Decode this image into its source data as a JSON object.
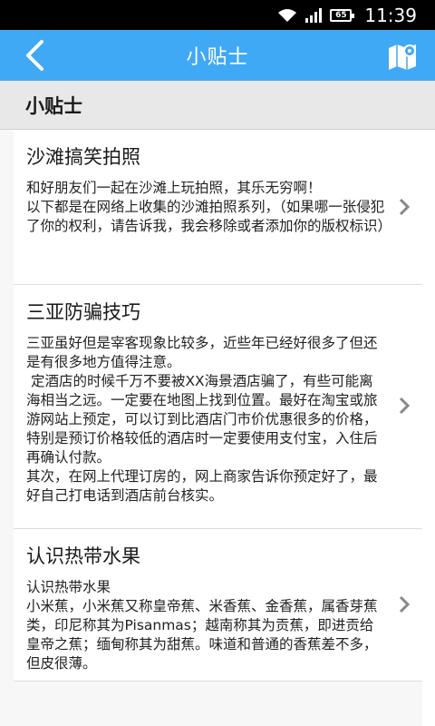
{
  "status_bar": {
    "battery": "65",
    "time": "11:39"
  },
  "app_bar": {
    "title": "小贴士"
  },
  "section": {
    "title": "小贴士"
  },
  "tips": [
    {
      "title": "沙滩搞笑拍照",
      "text": "和好朋友们一起在沙滩上玩拍照，其乐无穷啊！\n以下都是在网络上收集的沙滩拍照系列，（如果哪一张侵犯了你的权利，请告诉我，我会移除或者添加你的版权标识）"
    },
    {
      "title": "三亚防骗技巧",
      "text": "三亚虽好但是宰客现象比较多，近些年已经好很多了但还是有很多地方值得注意。\n 定酒店的时候千万不要被XX海景酒店骗了，有些可能离海相当之远。一定要在地图上找到位置。最好在淘宝或旅游网站上预定，可以订到比酒店门市价优惠很多的价格，特别是预订价格较低的酒店时一定要使用支付宝，入住后再确认付款。\n其次，在网上代理订房的，网上商家告诉你预定好了，最好自己打电话到酒店前台核实。"
    },
    {
      "title": "认识热带水果",
      "text": "认识热带水果\n小米蕉，小米蕉又称皇帝蕉、米香蕉、金香蕉，属香芽蕉类，印尼称其为Pisanmas；越南称其为贡蕉，即进贡给皇帝之蕉；缅甸称其为甜蕉。味道和普通的香蕉差不多，但皮很薄。"
    }
  ]
}
